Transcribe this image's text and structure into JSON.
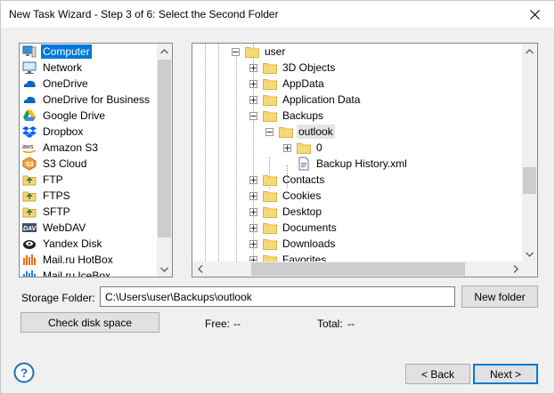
{
  "window": {
    "title": "New Task Wizard - Step 3 of 6: Select the Second Folder"
  },
  "sources": [
    {
      "label": "Computer",
      "icon": "computer-icon",
      "selected": true
    },
    {
      "label": "Network",
      "icon": "network-icon"
    },
    {
      "label": "OneDrive",
      "icon": "onedrive-icon"
    },
    {
      "label": "OneDrive for Business",
      "icon": "onedrive-business-icon"
    },
    {
      "label": "Google Drive",
      "icon": "google-drive-icon"
    },
    {
      "label": "Dropbox",
      "icon": "dropbox-icon"
    },
    {
      "label": "Amazon S3",
      "icon": "amazon-s3-icon"
    },
    {
      "label": "S3 Cloud",
      "icon": "s3-cloud-icon"
    },
    {
      "label": "FTP",
      "icon": "ftp-icon"
    },
    {
      "label": "FTPS",
      "icon": "ftps-icon"
    },
    {
      "label": "SFTP",
      "icon": "sftp-icon"
    },
    {
      "label": "WebDAV",
      "icon": "webdav-icon"
    },
    {
      "label": "Yandex Disk",
      "icon": "yandex-disk-icon"
    },
    {
      "label": "Mail.ru HotBox",
      "icon": "mailru-hotbox-icon"
    },
    {
      "label": "Mail.ru IceBox",
      "icon": "mailru-icebox-icon"
    }
  ],
  "tree": [
    {
      "label": "user",
      "level": 0,
      "toggle": "-",
      "type": "folder"
    },
    {
      "label": "3D Objects",
      "level": 1,
      "toggle": "+",
      "type": "folder"
    },
    {
      "label": "AppData",
      "level": 1,
      "toggle": "+",
      "type": "folder"
    },
    {
      "label": "Application Data",
      "level": 1,
      "toggle": "+",
      "type": "folder"
    },
    {
      "label": "Backups",
      "level": 1,
      "toggle": "-",
      "type": "folder"
    },
    {
      "label": "outlook",
      "level": 2,
      "toggle": "-",
      "type": "folder",
      "selected": true
    },
    {
      "label": "0",
      "level": 3,
      "toggle": "+",
      "type": "folder"
    },
    {
      "label": "Backup History.xml",
      "level": 3,
      "toggle": "",
      "type": "file"
    },
    {
      "label": "Contacts",
      "level": 1,
      "toggle": "+",
      "type": "folder"
    },
    {
      "label": "Cookies",
      "level": 1,
      "toggle": "+",
      "type": "folder"
    },
    {
      "label": "Desktop",
      "level": 1,
      "toggle": "+",
      "type": "folder"
    },
    {
      "label": "Documents",
      "level": 1,
      "toggle": "+",
      "type": "folder"
    },
    {
      "label": "Downloads",
      "level": 1,
      "toggle": "+",
      "type": "folder"
    },
    {
      "label": "Favorites",
      "level": 1,
      "toggle": "+",
      "type": "folder"
    }
  ],
  "storage": {
    "label": "Storage Folder:",
    "path": "C:\\Users\\user\\Backups\\outlook",
    "new_folder_label": "New folder"
  },
  "disk": {
    "check_label": "Check disk space",
    "free_label": "Free:",
    "free_value": "--",
    "total_label": "Total:",
    "total_value": "--"
  },
  "nav": {
    "back_label": "< Back",
    "next_label": "Next >"
  },
  "colors": {
    "accent": "#0078d7",
    "folder": "#f8d775"
  }
}
